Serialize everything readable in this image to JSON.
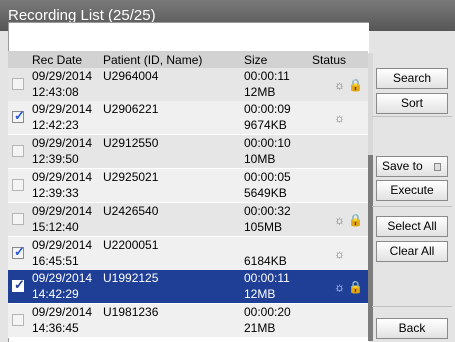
{
  "title": "Recording List  (25/25)",
  "columns": [
    "Rec Date",
    "Patient (ID, Name)",
    "Size",
    "Status"
  ],
  "rows": [
    {
      "date": "09/29/2014",
      "time": "12:43:08",
      "patient": "U2964004",
      "duration": "00:00:11",
      "size": "12MB",
      "checked": false,
      "status": "☼ 🔒",
      "selected": false
    },
    {
      "date": "09/29/2014",
      "time": "12:42:23",
      "patient": "U2906221",
      "duration": "00:00:09",
      "size": "9674KB",
      "checked": true,
      "status": "☼",
      "selected": false
    },
    {
      "date": "09/29/2014",
      "time": "12:39:50",
      "patient": "U2912550",
      "duration": "00:00:10",
      "size": "10MB",
      "checked": false,
      "status": "",
      "selected": false
    },
    {
      "date": "09/29/2014",
      "time": "12:39:33",
      "patient": "U2925021",
      "duration": "00:00:05",
      "size": "5649KB",
      "checked": false,
      "status": "",
      "selected": false
    },
    {
      "date": "09/29/2014",
      "time": "15:12:40",
      "patient": "U2426540",
      "duration": "00:00:32",
      "size": "105MB",
      "checked": false,
      "status": "☼ 🔒",
      "selected": false
    },
    {
      "date": "09/29/2014",
      "time": "16:45:51",
      "patient": "U2200051",
      "duration": "",
      "size": "6184KB",
      "checked": true,
      "status": "☼",
      "selected": false
    },
    {
      "date": "09/29/2014",
      "time": "14:42:29",
      "patient": "U1992125",
      "duration": "00:00:11",
      "size": "12MB",
      "checked": true,
      "status": "☼ 🔒",
      "selected": true
    },
    {
      "date": "09/29/2014",
      "time": "14:36:45",
      "patient": "U1981236",
      "duration": "00:00:20",
      "size": "21MB",
      "checked": false,
      "status": "",
      "selected": false
    }
  ],
  "buttons": {
    "search": "Search",
    "sort": "Sort",
    "save_to": "Save to",
    "execute": "Execute",
    "select_all": "Select All",
    "clear_all": "Clear All",
    "back": "Back"
  }
}
